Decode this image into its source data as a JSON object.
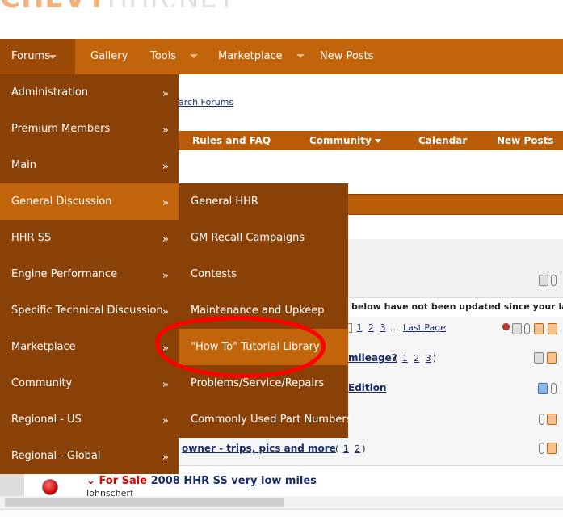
{
  "navbar": {
    "items": [
      {
        "label": "Forums",
        "has_caret": true,
        "active": true
      },
      {
        "label": "Gallery",
        "has_caret": false
      },
      {
        "label": "Tools",
        "has_caret": true
      },
      {
        "label": "Marketplace",
        "has_caret": true
      },
      {
        "label": "New Posts",
        "has_caret": false
      }
    ]
  },
  "page": {
    "search_link": "arch Forums",
    "subnav": {
      "rules": "Rules and FAQ",
      "community": "Community",
      "calendar": "Calendar",
      "new_posts": "New Posts"
    },
    "notice": "below have not been updated since your last vi",
    "threads": [
      {
        "title": "",
        "pager_pages": [
          "1",
          "2",
          "3"
        ],
        "pager_ellipsis": "...",
        "last_page": "Last Page"
      },
      {
        "title": "mileage?",
        "pager_pages": [
          "1",
          "2",
          "3"
        ]
      },
      {
        "title": "Edition"
      },
      {
        "title": "owner - trips, pics and more",
        "pager_pages": [
          "1",
          "2"
        ]
      }
    ],
    "for_sale": {
      "tag": "For Sale",
      "title": "2008 HHR SS very low miles",
      "author": "Johnscherf"
    }
  },
  "forums_menu": {
    "items": [
      {
        "label": "Administration",
        "arrow": "»"
      },
      {
        "label": "Premium Members",
        "arrow": "»"
      },
      {
        "label": "Main",
        "arrow": "»"
      },
      {
        "label": "General Discussion",
        "arrow": "»",
        "active": true
      },
      {
        "label": "HHR SS",
        "arrow": "»"
      },
      {
        "label": "Engine Performance",
        "arrow": "»"
      },
      {
        "label": "Specific Technical Discussion",
        "arrow": "»"
      },
      {
        "label": "Marketplace",
        "arrow": "»"
      },
      {
        "label": "Community",
        "arrow": "»"
      },
      {
        "label": "Regional - US",
        "arrow": "»"
      },
      {
        "label": "Regional - Global",
        "arrow": "»"
      }
    ]
  },
  "general_discussion_submenu": {
    "items": [
      {
        "label": "General HHR"
      },
      {
        "label": "GM Recall Campaigns"
      },
      {
        "label": "Contests"
      },
      {
        "label": "Maintenance and Upkeep"
      },
      {
        "label": "\"How To\" Tutorial Library",
        "active": true
      },
      {
        "label": "Problems/Service/Repairs"
      },
      {
        "label": "Commonly Used Part Numbers"
      }
    ]
  },
  "colors": {
    "nav_bar": "#c1640b",
    "menu_bg": "#8a4108",
    "menu_active": "#c1640b",
    "annotation_circle": "#ff0000"
  }
}
